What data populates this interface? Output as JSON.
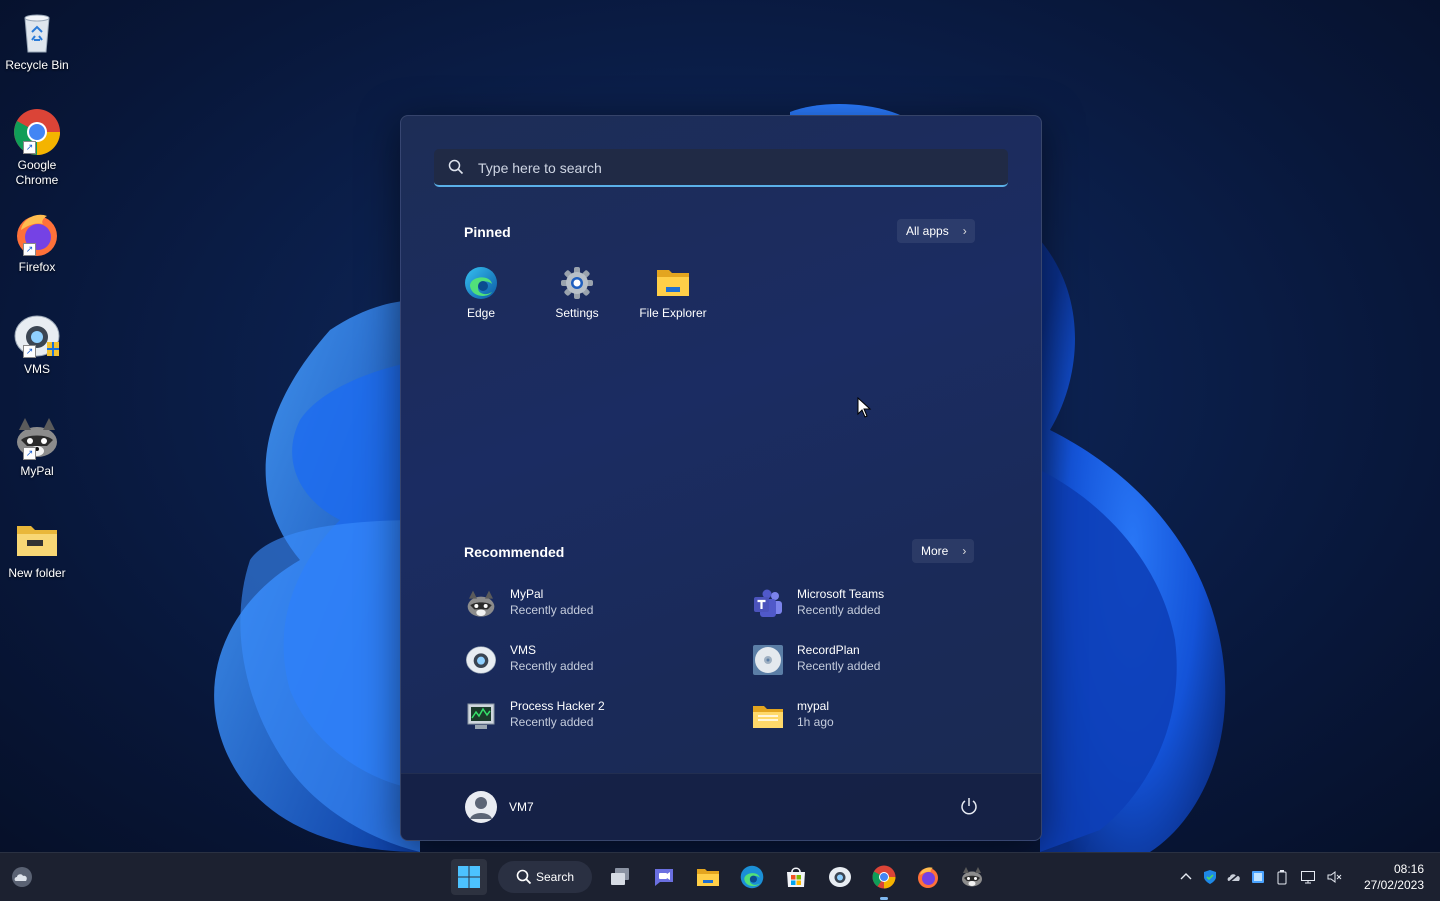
{
  "desktop": {
    "icons": [
      {
        "label": "Recycle Bin"
      },
      {
        "label": "Google Chrome"
      },
      {
        "label": "Firefox"
      },
      {
        "label": "VMS"
      },
      {
        "label": "MyPal"
      },
      {
        "label": "New folder"
      }
    ]
  },
  "start_menu": {
    "search_placeholder": "Type here to search",
    "pinned_title": "Pinned",
    "all_apps_label": "All apps",
    "pinned": [
      {
        "label": "Edge",
        "icon": "edge-icon"
      },
      {
        "label": "Settings",
        "icon": "gear-icon"
      },
      {
        "label": "File Explorer",
        "icon": "folder-icon"
      }
    ],
    "recommended_title": "Recommended",
    "more_label": "More",
    "recommended": [
      {
        "name": "MyPal",
        "sub": "Recently added",
        "icon": "mypal-icon"
      },
      {
        "name": "Microsoft Teams",
        "sub": "Recently added",
        "icon": "teams-icon"
      },
      {
        "name": "VMS",
        "sub": "Recently added",
        "icon": "vms-icon"
      },
      {
        "name": "RecordPlan",
        "sub": "Recently added",
        "icon": "disc-icon"
      },
      {
        "name": "Process Hacker 2",
        "sub": "Recently added",
        "icon": "process-hacker-icon"
      },
      {
        "name": "mypal",
        "sub": "1h ago",
        "icon": "folder-icon"
      }
    ],
    "user_name": "VM7"
  },
  "taskbar": {
    "search_label": "Search",
    "time": "08:16",
    "date": "27/02/2023",
    "accent": "#7fb8f0"
  }
}
